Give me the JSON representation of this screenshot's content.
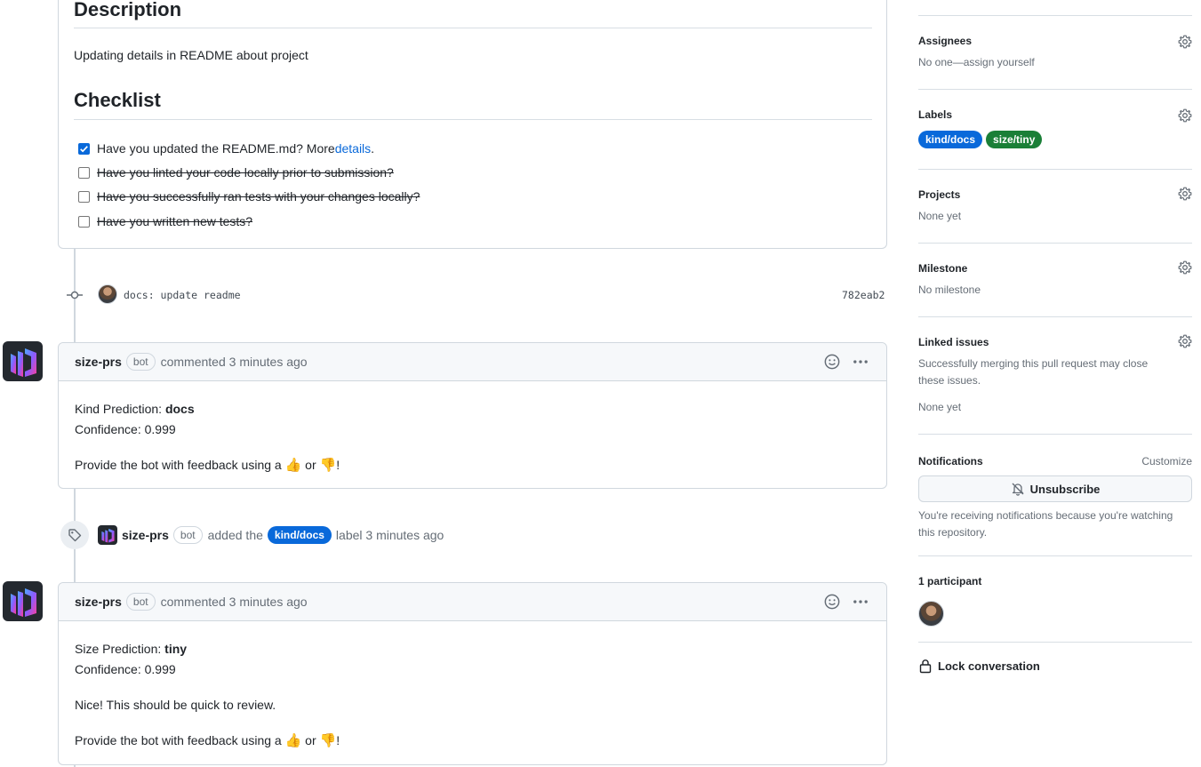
{
  "description": {
    "heading": "Description",
    "text": "Updating details in README about project",
    "checklist_heading": "Checklist",
    "tasks": [
      {
        "label": "Have you updated the README.md? More ",
        "link": "details",
        "suffix": ".",
        "checked": true,
        "strikethrough": false
      },
      {
        "label": "Have you linted your code locally prior to submission?",
        "checked": false,
        "strikethrough": true
      },
      {
        "label": "Have you successfully ran tests with your changes locally?",
        "checked": false,
        "strikethrough": true
      },
      {
        "label": "Have you written new tests?",
        "checked": false,
        "strikethrough": true
      }
    ]
  },
  "commit": {
    "message": "docs: update readme",
    "sha": "782eab2"
  },
  "comments": [
    {
      "author": "size-prs",
      "badge": "bot",
      "action": "commented 3 minutes ago",
      "prediction_label": "Kind Prediction: ",
      "prediction_value": "docs",
      "confidence": "Confidence: 0.999",
      "extra": "",
      "feedback_prefix": "Provide the bot with feedback using a ",
      "feedback_or": " or ",
      "feedback_suffix": "!"
    },
    {
      "author": "size-prs",
      "badge": "bot",
      "action": "commented 3 minutes ago",
      "prediction_label": "Size Prediction: ",
      "prediction_value": "tiny",
      "confidence": "Confidence: 0.999",
      "extra": "Nice! This should be quick to review.",
      "feedback_prefix": "Provide the bot with feedback using a ",
      "feedback_or": " or ",
      "feedback_suffix": "!"
    }
  ],
  "label_event": {
    "author": "size-prs",
    "badge": "bot",
    "added_the": "added the",
    "label": "kind/docs",
    "suffix": "label 3 minutes ago"
  },
  "sidebar": {
    "assignees": {
      "title": "Assignees",
      "value": "No one—assign yourself"
    },
    "labels": {
      "title": "Labels",
      "items": [
        {
          "name": "kind/docs",
          "color": "#0969da"
        },
        {
          "name": "size/tiny",
          "color": "#1a7f37"
        }
      ]
    },
    "projects": {
      "title": "Projects",
      "value": "None yet"
    },
    "milestone": {
      "title": "Milestone",
      "value": "No milestone"
    },
    "linked_issues": {
      "title": "Linked issues",
      "description": "Successfully merging this pull request may close these issues.",
      "value": "None yet"
    },
    "notifications": {
      "title": "Notifications",
      "customize": "Customize",
      "button": "Unsubscribe",
      "note": "You're receiving notifications because you're watching this repository."
    },
    "participants": {
      "title": "1 participant"
    },
    "lock": {
      "label": "Lock conversation"
    }
  },
  "colors": {
    "accent": "#0969da",
    "label_docs": "#0969da",
    "label_tiny": "#1a7f37"
  }
}
